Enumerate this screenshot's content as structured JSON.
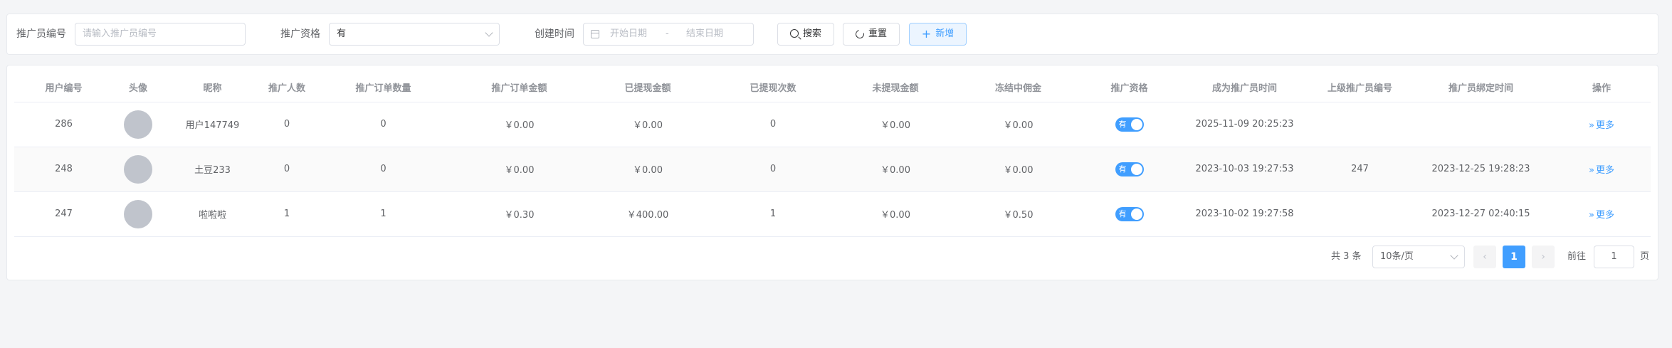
{
  "search": {
    "promoter_id_label": "推广员编号",
    "promoter_id_placeholder": "请输入推广员编号",
    "qualification_label": "推广资格",
    "qualification_value": "有",
    "created_time_label": "创建时间",
    "start_date_placeholder": "开始日期",
    "date_separator": "-",
    "end_date_placeholder": "结束日期",
    "search_button": "搜索",
    "reset_button": "重置",
    "add_button": "新增"
  },
  "table": {
    "columns": [
      "用户编号",
      "头像",
      "昵称",
      "推广人数",
      "推广订单数量",
      "推广订单金额",
      "已提现金额",
      "已提现次数",
      "未提现金额",
      "冻结中佣金",
      "推广资格",
      "成为推广员时间",
      "上级推广员编号",
      "推广员绑定时间",
      "操作"
    ],
    "rows": [
      {
        "user_id": "286",
        "nickname": "用户147749",
        "promoted_count": "0",
        "order_count": "0",
        "order_amount": "￥0.00",
        "withdrawn_amount": "￥0.00",
        "withdraw_times": "0",
        "unwithdrawn_amount": "￥0.00",
        "frozen_commission": "￥0.00",
        "qualification": "有",
        "became_time": "2025-11-09 20:25:23",
        "parent_id": "",
        "bind_time": "",
        "action": "更多"
      },
      {
        "user_id": "248",
        "nickname": "土豆233",
        "promoted_count": "0",
        "order_count": "0",
        "order_amount": "￥0.00",
        "withdrawn_amount": "￥0.00",
        "withdraw_times": "0",
        "unwithdrawn_amount": "￥0.00",
        "frozen_commission": "￥0.00",
        "qualification": "有",
        "became_time": "2023-10-03 19:27:53",
        "parent_id": "247",
        "bind_time": "2023-12-25 19:28:23",
        "action": "更多"
      },
      {
        "user_id": "247",
        "nickname": "啦啦啦",
        "promoted_count": "1",
        "order_count": "1",
        "order_amount": "￥0.30",
        "withdrawn_amount": "￥400.00",
        "withdraw_times": "1",
        "unwithdrawn_amount": "￥0.00",
        "frozen_commission": "￥0.50",
        "qualification": "有",
        "became_time": "2023-10-02 19:27:58",
        "parent_id": "",
        "bind_time": "2023-12-27 02:40:15",
        "action": "更多"
      }
    ]
  },
  "pagination": {
    "total_text": "共 3 条",
    "page_size": "10条/页",
    "prev": "‹",
    "current_page": "1",
    "next": "›",
    "goto_label": "前往",
    "goto_value": "1",
    "page_suffix": "页"
  },
  "colors": {
    "primary": "#409eff",
    "background": "#f4f5f7",
    "avatar": "#c0c4cc"
  }
}
